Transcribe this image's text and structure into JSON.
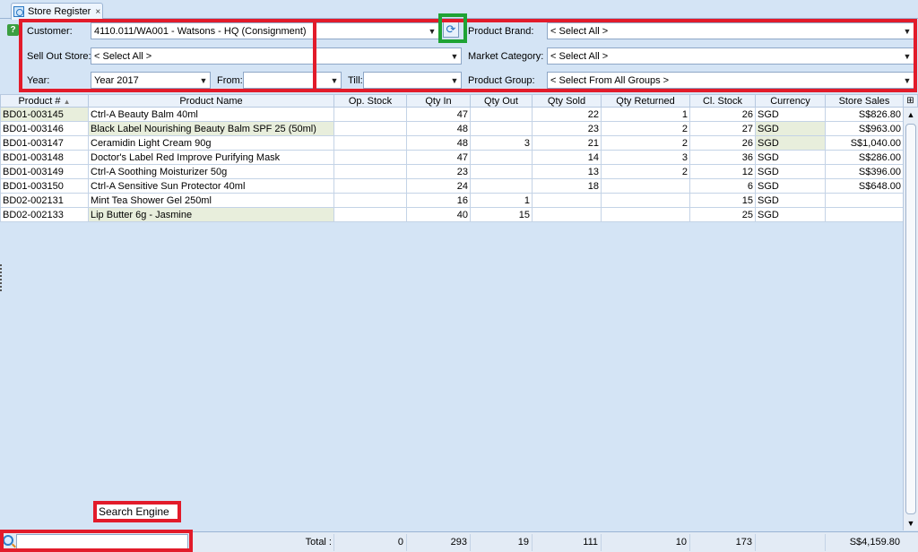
{
  "tab": {
    "label": "Store Register",
    "close": "×"
  },
  "filters": {
    "help": "?",
    "customer_label": "Customer:",
    "customer_value": "4110.011/WA001 - Watsons - HQ (Consignment)",
    "product_brand_label": "Product Brand:",
    "product_brand_value": "< Select All >",
    "sell_out_store_label": "Sell Out Store:",
    "sell_out_store_value": "< Select All >",
    "market_category_label": "Market Category:",
    "market_category_value": "< Select All >",
    "year_label": "Year:",
    "year_value": "Year 2017",
    "from_label": "From:",
    "from_value": "",
    "till_label": "Till:",
    "till_value": "",
    "product_group_label": "Product Group:",
    "product_group_value": "< Select From All Groups >"
  },
  "grid": {
    "columns": [
      "Product #",
      "Product Name",
      "Op. Stock",
      "Qty In",
      "Qty Out",
      "Qty Sold",
      "Qty Returned",
      "Cl. Stock",
      "Currency",
      "Store Sales"
    ],
    "sort_indicator": "▲",
    "rows": [
      [
        "BD01-003145",
        "Ctrl-A Beauty Balm   40ml",
        "",
        "47",
        "",
        "22",
        "1",
        "26",
        "SGD",
        "S$826.80"
      ],
      [
        "BD01-003146",
        "Black Label Nourishing Beauty Balm SPF 25 (50ml)",
        "",
        "48",
        "",
        "23",
        "2",
        "27",
        "SGD",
        "S$963.00"
      ],
      [
        "BD01-003147",
        "Ceramidin Light Cream 90g",
        "",
        "48",
        "3",
        "21",
        "2",
        "26",
        "SGD",
        "S$1,040.00"
      ],
      [
        "BD01-003148",
        "Doctor's Label Red Improve Purifying Mask",
        "",
        "47",
        "",
        "14",
        "3",
        "36",
        "SGD",
        "S$286.00"
      ],
      [
        "BD01-003149",
        "Ctrl-A Soothing Moisturizer   50g",
        "",
        "23",
        "",
        "13",
        "2",
        "12",
        "SGD",
        "S$396.00"
      ],
      [
        "BD01-003150",
        "Ctrl-A Sensitive Sun Protector   40ml",
        "",
        "24",
        "",
        "18",
        "",
        "6",
        "SGD",
        "S$648.00"
      ],
      [
        "BD02-002131",
        "Mint Tea Shower Gel   250ml",
        "",
        "16",
        "1",
        "",
        "",
        "15",
        "SGD",
        ""
      ],
      [
        "BD02-002133",
        "Lip Butter   6g - Jasmine",
        "",
        "40",
        "15",
        "",
        "",
        "25",
        "SGD",
        ""
      ]
    ]
  },
  "footer": {
    "search_placeholder": "",
    "total_label": "Total :",
    "totals": [
      "0",
      "293",
      "19",
      "111",
      "10",
      "173",
      "",
      "S$4,159.80"
    ]
  },
  "annotation": {
    "search_engine": "Search Engine"
  },
  "colors": {
    "highlight_box": "#e21b2a",
    "refresh_box": "#1fa334",
    "background": "#d4e4f5"
  }
}
